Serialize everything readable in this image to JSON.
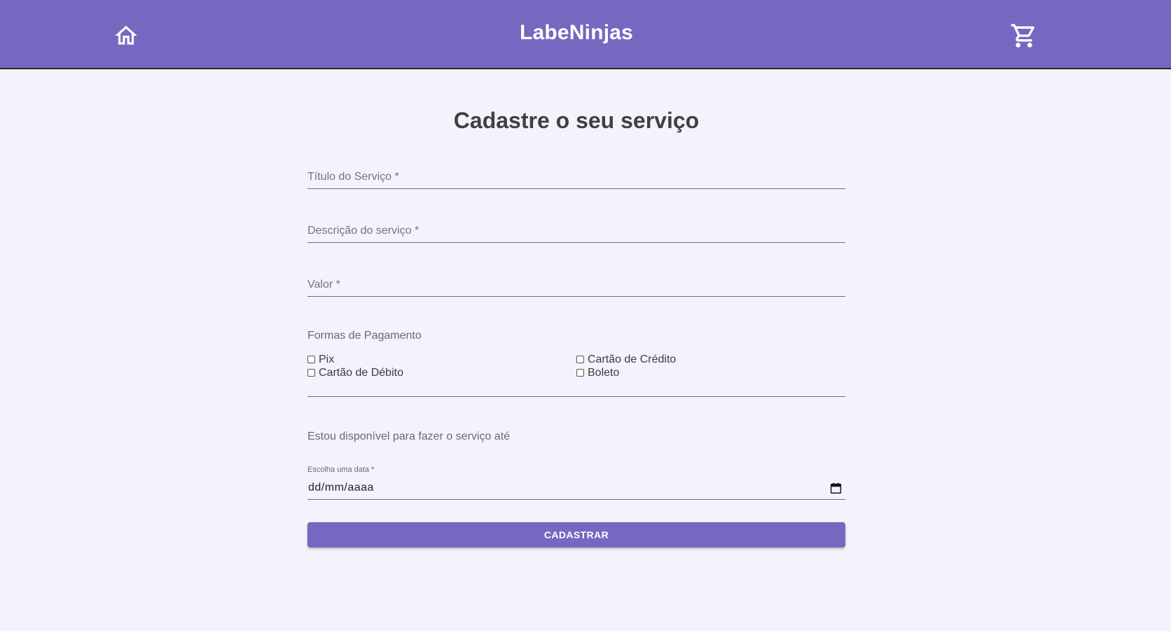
{
  "header": {
    "title": "LabeNinjas",
    "home_icon": "home-icon",
    "cart_icon": "cart-icon",
    "background_color": "#7767c0"
  },
  "form": {
    "title": "Cadastre o seu serviço",
    "fields": {
      "titulo": {
        "placeholder": "Título do Serviço *",
        "value": ""
      },
      "descricao": {
        "placeholder": "Descrição do serviço *",
        "value": ""
      },
      "valor": {
        "placeholder": "Valor *",
        "value": ""
      }
    },
    "payment": {
      "label": "Formas de Pagamento",
      "options": [
        {
          "label": "Pix",
          "checked": false
        },
        {
          "label": "Cartão de Crédito",
          "checked": false
        },
        {
          "label": "Cartão de Débito",
          "checked": false
        },
        {
          "label": "Boleto",
          "checked": false
        }
      ]
    },
    "availability": {
      "label": "Estou disponível para fazer o serviço até",
      "date_caption": "Escolha uma data *",
      "date_value": "dd/mm/aaaa"
    },
    "submit_label": "CADASTRAR"
  }
}
